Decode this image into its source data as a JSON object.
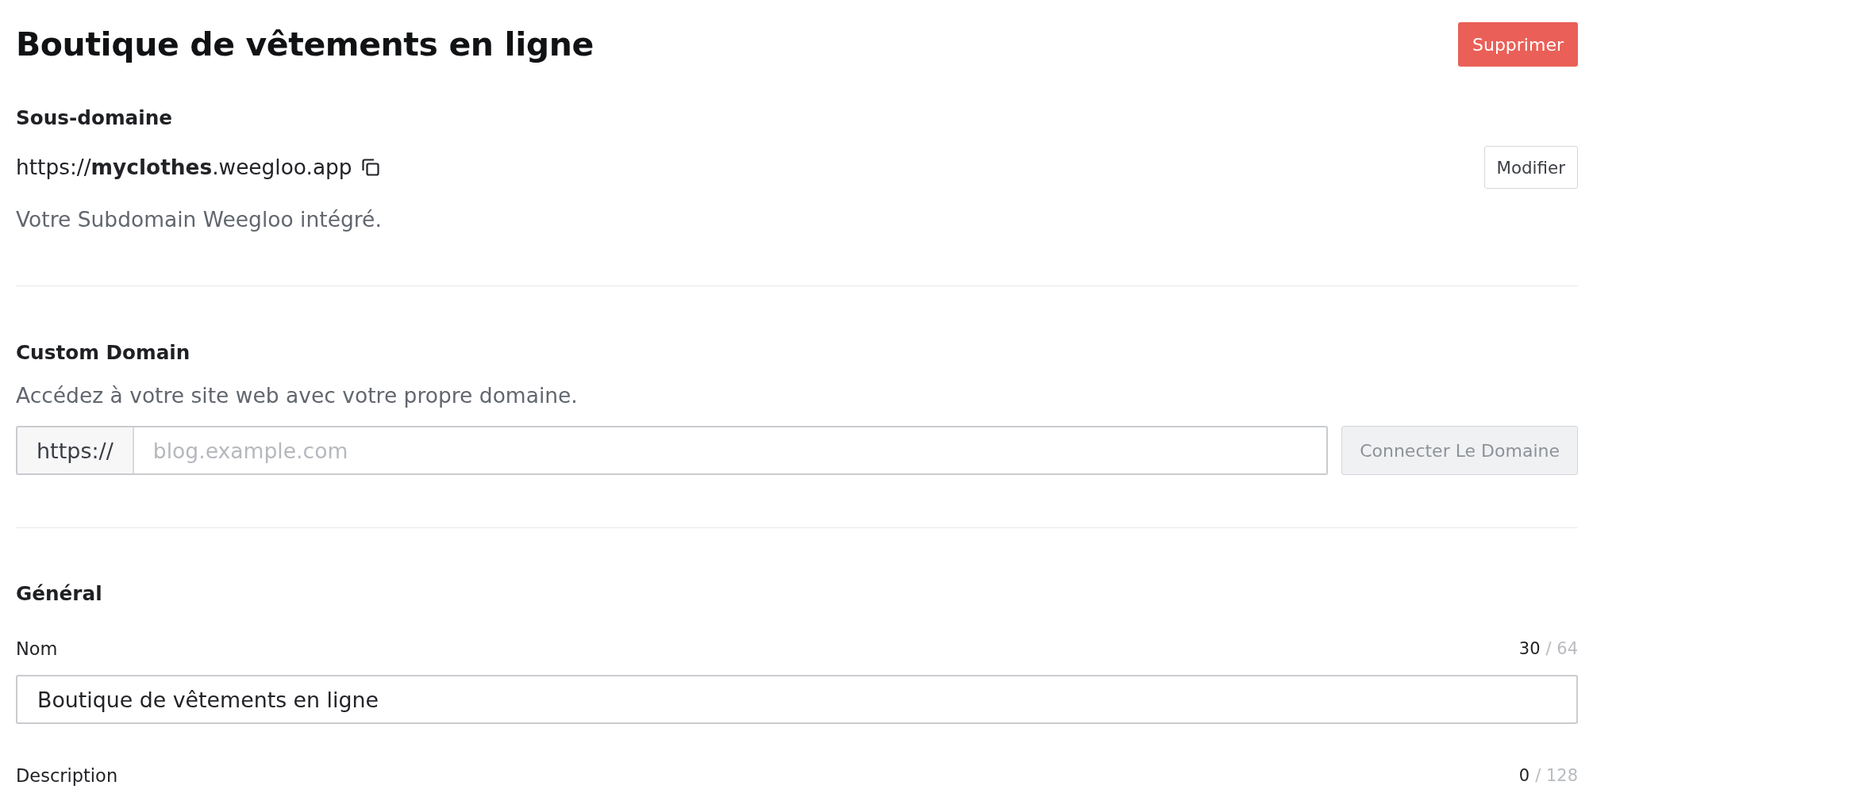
{
  "header": {
    "title": "Boutique de vêtements en ligne",
    "delete_button": "Supprimer"
  },
  "subdomain": {
    "heading": "Sous-domaine",
    "url": "https://**myclothes**.weegloo.app",
    "edit_button": "Modifier",
    "help": "Votre Subdomain Weegloo intégré."
  },
  "custom_domain": {
    "heading": "Custom Domain",
    "help": "Accédez à votre site web avec votre propre domaine.",
    "prefix": "https://",
    "placeholder": "blog.example.com",
    "connect_button": {
      "label": "Connecter Le Domaine",
      "disabled": true
    }
  },
  "general": {
    "heading": "Général",
    "fields": [
      {
        "label": "Nom",
        "count": "30",
        "limit": "/ 64",
        "value": "Boutique de vêtements en ligne"
      },
      {
        "label": "Description",
        "count": "0",
        "limit": "/ 128"
      }
    ]
  }
}
